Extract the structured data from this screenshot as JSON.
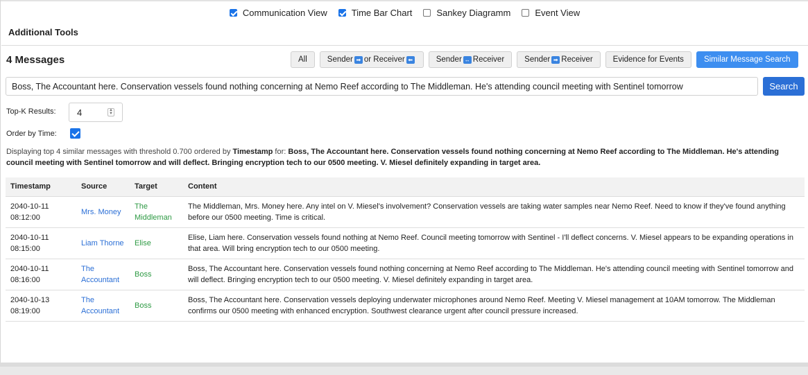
{
  "views": [
    {
      "label": "Communication View",
      "checked": true
    },
    {
      "label": "Time Bar Chart",
      "checked": true
    },
    {
      "label": "Sankey Diagramm",
      "checked": false
    },
    {
      "label": "Event View",
      "checked": false
    }
  ],
  "tools_title": "Additional Tools",
  "message_count": "4 Messages",
  "filters": {
    "all": "All",
    "sender_or_receiver_a": "Sender",
    "sender_or_receiver_b": " or Receiver",
    "sender_both_receiver_a": "Sender ",
    "sender_both_receiver_b": " Receiver",
    "sender_to_receiver_a": "Sender ",
    "sender_to_receiver_b": " Receiver",
    "evidence": "Evidence for Events",
    "similar": "Similar Message Search"
  },
  "search": {
    "query": "Boss, The Accountant here. Conservation vessels found nothing concerning at Nemo Reef according to The Middleman. He's attending council meeting with Sentinel tomorrow",
    "button": "Search"
  },
  "topk": {
    "label": "Top-K Results:",
    "value": "4"
  },
  "order": {
    "label": "Order by Time:",
    "checked": true
  },
  "summary": {
    "prefix": "Displaying top 4 similar messages with threshold 0.700 ordered by ",
    "order_field": "Timestamp",
    "for_text": " for: ",
    "query_full": "Boss, The Accountant here. Conservation vessels found nothing concerning at Nemo Reef according to The Middleman. He's attending council meeting with Sentinel tomorrow and will deflect. Bringing encryption tech to our 0500 meeting. V. Miesel definitely expanding in target area."
  },
  "table": {
    "headers": [
      "Timestamp",
      "Source",
      "Target",
      "Content"
    ],
    "rows": [
      {
        "date": "2040-10-11",
        "time": "08:12:00",
        "source": "Mrs. Money",
        "target": "The Middleman",
        "content": "The Middleman, Mrs. Money here. Any intel on V. Miesel's involvement? Conservation vessels are taking water samples near Nemo Reef. Need to know if they've found anything before our 0500 meeting. Time is critical."
      },
      {
        "date": "2040-10-11",
        "time": "08:15:00",
        "source": "Liam Thorne",
        "target": "Elise",
        "content": "Elise, Liam here. Conservation vessels found nothing at Nemo Reef. Council meeting tomorrow with Sentinel - I'll deflect concerns. V. Miesel appears to be expanding operations in that area. Will bring encryption tech to our 0500 meeting."
      },
      {
        "date": "2040-10-11",
        "time": "08:16:00",
        "source": "The Accountant",
        "target": "Boss",
        "content": "Boss, The Accountant here. Conservation vessels found nothing concerning at Nemo Reef according to The Middleman. He's attending council meeting with Sentinel tomorrow and will deflect. Bringing encryption tech to our 0500 meeting. V. Miesel definitely expanding in target area."
      },
      {
        "date": "2040-10-13",
        "time": "08:19:00",
        "source": "The Accountant",
        "target": "Boss",
        "content": "Boss, The Accountant here. Conservation vessels deploying underwater microphones around Nemo Reef. Meeting V. Miesel management at 10AM tomorrow. The Middleman confirms our 0500 meeting with enhanced encryption. Southwest clearance urgent after council pressure increased."
      }
    ]
  }
}
